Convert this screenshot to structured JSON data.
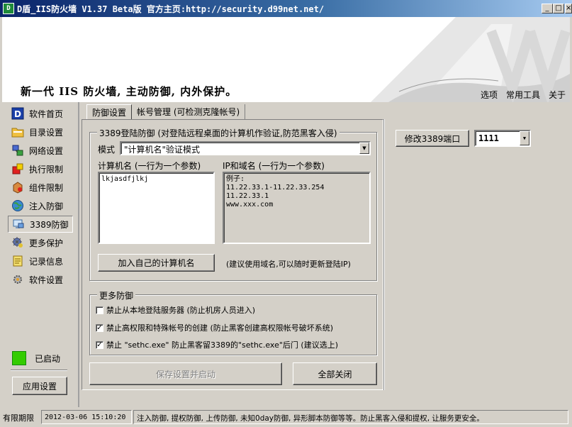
{
  "window": {
    "app_icon_text": "D",
    "title": "D盾_IIS防火墙 V1.37 Beta版  官方主页:http://security.d99net.net/",
    "min_label": "_",
    "max_label": "□",
    "close_label": "×"
  },
  "banner": {
    "slogan": "新一代 IIS 防火墙, 主动防御, 内外保护。",
    "menu": [
      "选项",
      "常用工具",
      "关于"
    ]
  },
  "sidebar": {
    "items": [
      {
        "label": "软件首页",
        "icon": "d-logo-icon"
      },
      {
        "label": "目录设置",
        "icon": "folder-icon"
      },
      {
        "label": "网络设置",
        "icon": "network-icon"
      },
      {
        "label": "执行限制",
        "icon": "block-icon"
      },
      {
        "label": "组件限制",
        "icon": "component-icon"
      },
      {
        "label": "注入防御",
        "icon": "globe-icon"
      },
      {
        "label": "3389防御",
        "icon": "remote-desktop-icon"
      },
      {
        "label": "更多保护",
        "icon": "shield-icon"
      },
      {
        "label": "记录信息",
        "icon": "log-icon"
      },
      {
        "label": "软件设置",
        "icon": "gear-icon"
      }
    ],
    "active_index": 6,
    "status_label": "已启动",
    "status_color": "#33cc00",
    "apply_label": "应用设置"
  },
  "tabs": [
    {
      "label": "防御设置",
      "active": true
    },
    {
      "label": "帐号管理 (可检测克隆帐号)",
      "active": false
    }
  ],
  "rdp_group": {
    "title": "3389登陆防御 (对登陆远程桌面的计算机作验证,防范黑客入侵)",
    "mode_label": "模式",
    "mode_value": "\"计算机名\"验证模式",
    "computer_name_label": "计算机名 (一行为一个参数)",
    "computer_name_value": "lkjasdfjlkj",
    "ip_label": "IP和域名 (一行为一个参数)",
    "ip_value": "例子:\n11.22.33.1-11.22.33.254\n11.22.33.1\nwww.xxx.com",
    "add_button": "加入自己的计算机名",
    "hint": "(建议使用域名,可以随时更新登陆IP)"
  },
  "more_group": {
    "title": "更多防御",
    "options": [
      {
        "label": "禁止从本地登陆服务器 (防止机房人员进入)",
        "checked": false
      },
      {
        "label": "禁止高权限和特殊帐号的创建 (防止黑客创建高权限帐号破坏系统)",
        "checked": true
      },
      {
        "label": "禁止 \"sethc.exe\" 防止黑客留3389的\"sethc.exe\"后门 (建议选上)",
        "checked": true
      }
    ]
  },
  "actions": {
    "save_label": "保存设置并启动",
    "close_all_label": "全部关闭"
  },
  "port": {
    "button_label": "修改3389端口",
    "value": "1111"
  },
  "statusbar": {
    "license": "有限期限",
    "datetime": "2012-03-06 15:10:20",
    "message": "注入防御, 提权防御, 上传防御, 未知0day防御, 异形脚本防御等等。防止黑客入侵和提权, 让服务更安全。"
  }
}
